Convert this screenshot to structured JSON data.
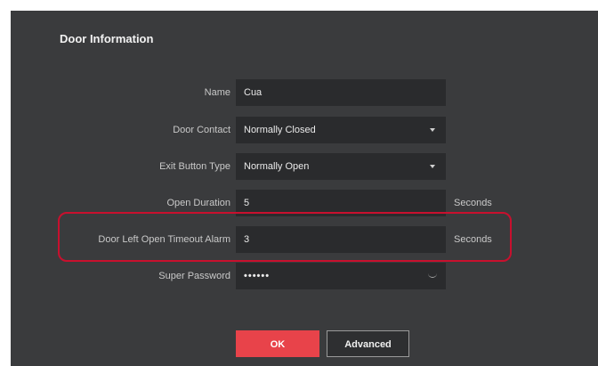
{
  "section": {
    "title": "Door Information"
  },
  "fields": {
    "name": {
      "label": "Name",
      "value": "Cua"
    },
    "door_contact": {
      "label": "Door Contact",
      "value": "Normally Closed"
    },
    "exit_button_type": {
      "label": "Exit Button Type",
      "value": "Normally Open"
    },
    "open_duration": {
      "label": "Open Duration",
      "value": "5",
      "unit": "Seconds"
    },
    "door_left_open_timeout_alarm": {
      "label": "Door Left Open Timeout Alarm",
      "value": "3",
      "unit": "Seconds"
    },
    "super_password": {
      "label": "Super Password",
      "value": "••••••"
    }
  },
  "buttons": {
    "ok_label": "OK",
    "advanced_label": "Advanced"
  },
  "colors": {
    "panel_bg": "#3a3b3d",
    "field_bg": "#2a2b2d",
    "ok_button": "#e8434a",
    "highlight_border": "#c8102e"
  },
  "icons": {
    "dropdown": "chevron-down-icon",
    "password_visibility": "eye-closed-icon"
  }
}
